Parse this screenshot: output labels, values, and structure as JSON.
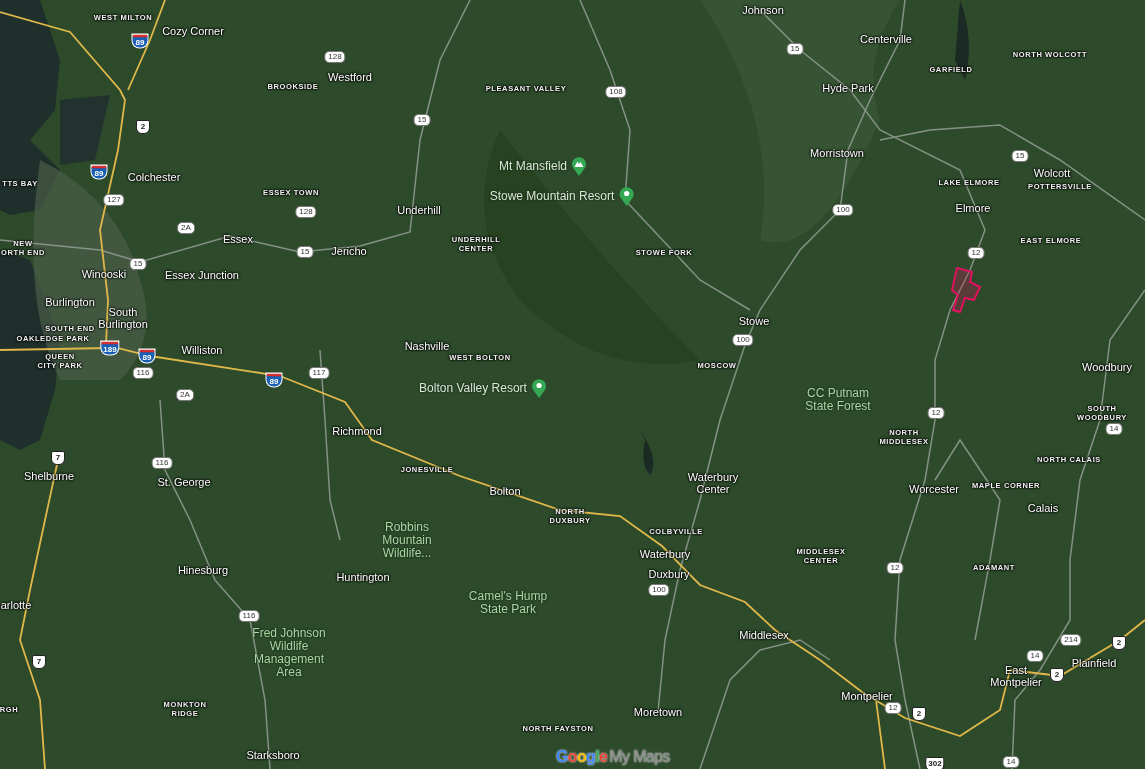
{
  "map": {
    "places": [
      {
        "text": "Cozy Corner"
      },
      {
        "text": "Westford"
      },
      {
        "text": "Johnson"
      },
      {
        "text": "Centerville"
      },
      {
        "text": "Hyde Park"
      },
      {
        "text": "Morristown"
      },
      {
        "text": "Wolcott"
      },
      {
        "text": "Colchester"
      },
      {
        "text": "Elmore"
      },
      {
        "text": "Underhill"
      },
      {
        "text": "Essex"
      },
      {
        "text": "Jericho"
      },
      {
        "text": "Winooski"
      },
      {
        "text": "Essex Junction"
      },
      {
        "text": "Burlington"
      },
      {
        "lines": [
          "South",
          "Burlington"
        ]
      },
      {
        "text": "Stowe"
      },
      {
        "text": "Williston"
      },
      {
        "text": "Nashville"
      },
      {
        "text": "Woodbury"
      },
      {
        "text": "Richmond"
      },
      {
        "text": "Shelburne"
      },
      {
        "text": "St. George"
      },
      {
        "text": "Bolton"
      },
      {
        "lines": [
          "Waterbury",
          "Center"
        ]
      },
      {
        "text": "Worcester"
      },
      {
        "text": "Calais"
      },
      {
        "text": "Waterbury"
      },
      {
        "text": "Hinesburg"
      },
      {
        "text": "Huntington"
      },
      {
        "text": "Duxbury"
      },
      {
        "text": "arlotte"
      },
      {
        "text": "Middlesex"
      },
      {
        "text": "Plainfield"
      },
      {
        "lines": [
          "East",
          "Montpelier"
        ]
      },
      {
        "text": "Montpelier"
      },
      {
        "text": "Moretown"
      },
      {
        "text": "Starksboro"
      }
    ],
    "localities": [
      {
        "lines": [
          "WEST MILTON"
        ]
      },
      {
        "lines": [
          "NORTH WOLCOTT"
        ]
      },
      {
        "lines": [
          "GARFIELD"
        ]
      },
      {
        "lines": [
          "BROOKSIDE"
        ]
      },
      {
        "lines": [
          "PLEASANT VALLEY"
        ]
      },
      {
        "lines": [
          "TTS BAY"
        ]
      },
      {
        "lines": [
          "LAKE ELMORE"
        ]
      },
      {
        "lines": [
          "POTTERSVILLE"
        ]
      },
      {
        "lines": [
          "ESSEX TOWN"
        ]
      },
      {
        "lines": [
          "UNDERHILL",
          "CENTER"
        ]
      },
      {
        "lines": [
          "STOWE FORK"
        ]
      },
      {
        "lines": [
          "EAST ELMORE"
        ]
      },
      {
        "lines": [
          "NEW",
          "ORTH END"
        ]
      },
      {
        "lines": [
          "SOUTH END"
        ]
      },
      {
        "lines": [
          "OAKLEDGE PARK"
        ]
      },
      {
        "lines": [
          "QUEEN",
          "CITY PARK"
        ]
      },
      {
        "lines": [
          "WEST BOLTON"
        ]
      },
      {
        "lines": [
          "MOSCOW"
        ]
      },
      {
        "lines": [
          "SOUTH",
          "WOODBURY"
        ]
      },
      {
        "lines": [
          "NORTH",
          "MIDDLESEX"
        ]
      },
      {
        "lines": [
          "NORTH CALAIS"
        ]
      },
      {
        "lines": [
          "JONESVILLE"
        ]
      },
      {
        "lines": [
          "MAPLE CORNER"
        ]
      },
      {
        "lines": [
          "NORTH",
          "DUXBURY"
        ]
      },
      {
        "lines": [
          "COLBYVILLE"
        ]
      },
      {
        "lines": [
          "MIDDLESEX",
          "CENTER"
        ]
      },
      {
        "lines": [
          "ADAMANT"
        ]
      },
      {
        "lines": [
          "RGH"
        ]
      },
      {
        "lines": [
          "MONKTON",
          "RIDGE"
        ]
      },
      {
        "lines": [
          "NORTH FAYSTON"
        ]
      }
    ],
    "parks": [
      {
        "lines": [
          "CC Putnam",
          "State Forest"
        ]
      },
      {
        "lines": [
          "Robbins",
          "Mountain",
          "Wildlife..."
        ]
      },
      {
        "lines": [
          "Camel's Hump",
          "State Park"
        ]
      },
      {
        "lines": [
          "Fred Johnson",
          "Wildlife",
          "Management",
          "Area"
        ]
      }
    ],
    "points_of_interest": [
      {
        "text": "Mt Mansfield",
        "kind": "peak"
      },
      {
        "text": "Stowe Mountain Resort",
        "kind": "place"
      },
      {
        "text": "Bolton Valley Resort",
        "kind": "place"
      }
    ],
    "route_shields": [
      {
        "number": "89",
        "kind": "interstate"
      },
      {
        "number": "15",
        "kind": "state"
      },
      {
        "number": "128",
        "kind": "state"
      },
      {
        "number": "108",
        "kind": "state"
      },
      {
        "number": "2",
        "kind": "us"
      },
      {
        "number": "15",
        "kind": "state"
      },
      {
        "number": "15",
        "kind": "state"
      },
      {
        "number": "89",
        "kind": "interstate"
      },
      {
        "number": "127",
        "kind": "state"
      },
      {
        "number": "100",
        "kind": "state"
      },
      {
        "number": "128",
        "kind": "state"
      },
      {
        "number": "2A",
        "kind": "state"
      },
      {
        "number": "15",
        "kind": "state"
      },
      {
        "number": "12",
        "kind": "state"
      },
      {
        "number": "15",
        "kind": "state"
      },
      {
        "number": "100",
        "kind": "state"
      },
      {
        "number": "189",
        "kind": "interstate"
      },
      {
        "number": "89",
        "kind": "interstate"
      },
      {
        "number": "116",
        "kind": "state"
      },
      {
        "number": "117",
        "kind": "state"
      },
      {
        "number": "89",
        "kind": "interstate"
      },
      {
        "number": "2A",
        "kind": "state"
      },
      {
        "number": "12",
        "kind": "state"
      },
      {
        "number": "14",
        "kind": "state"
      },
      {
        "number": "7",
        "kind": "us"
      },
      {
        "number": "116",
        "kind": "state"
      },
      {
        "number": "12",
        "kind": "state"
      },
      {
        "number": "100",
        "kind": "state"
      },
      {
        "number": "116",
        "kind": "state"
      },
      {
        "number": "2",
        "kind": "us"
      },
      {
        "number": "214",
        "kind": "state"
      },
      {
        "number": "14",
        "kind": "state"
      },
      {
        "number": "7",
        "kind": "us"
      },
      {
        "number": "2",
        "kind": "us"
      },
      {
        "number": "12",
        "kind": "state"
      },
      {
        "number": "2",
        "kind": "us"
      },
      {
        "number": "302",
        "kind": "us"
      },
      {
        "number": "14",
        "kind": "state"
      }
    ],
    "logo": {
      "brand": "Google",
      "product": "My Maps"
    }
  }
}
